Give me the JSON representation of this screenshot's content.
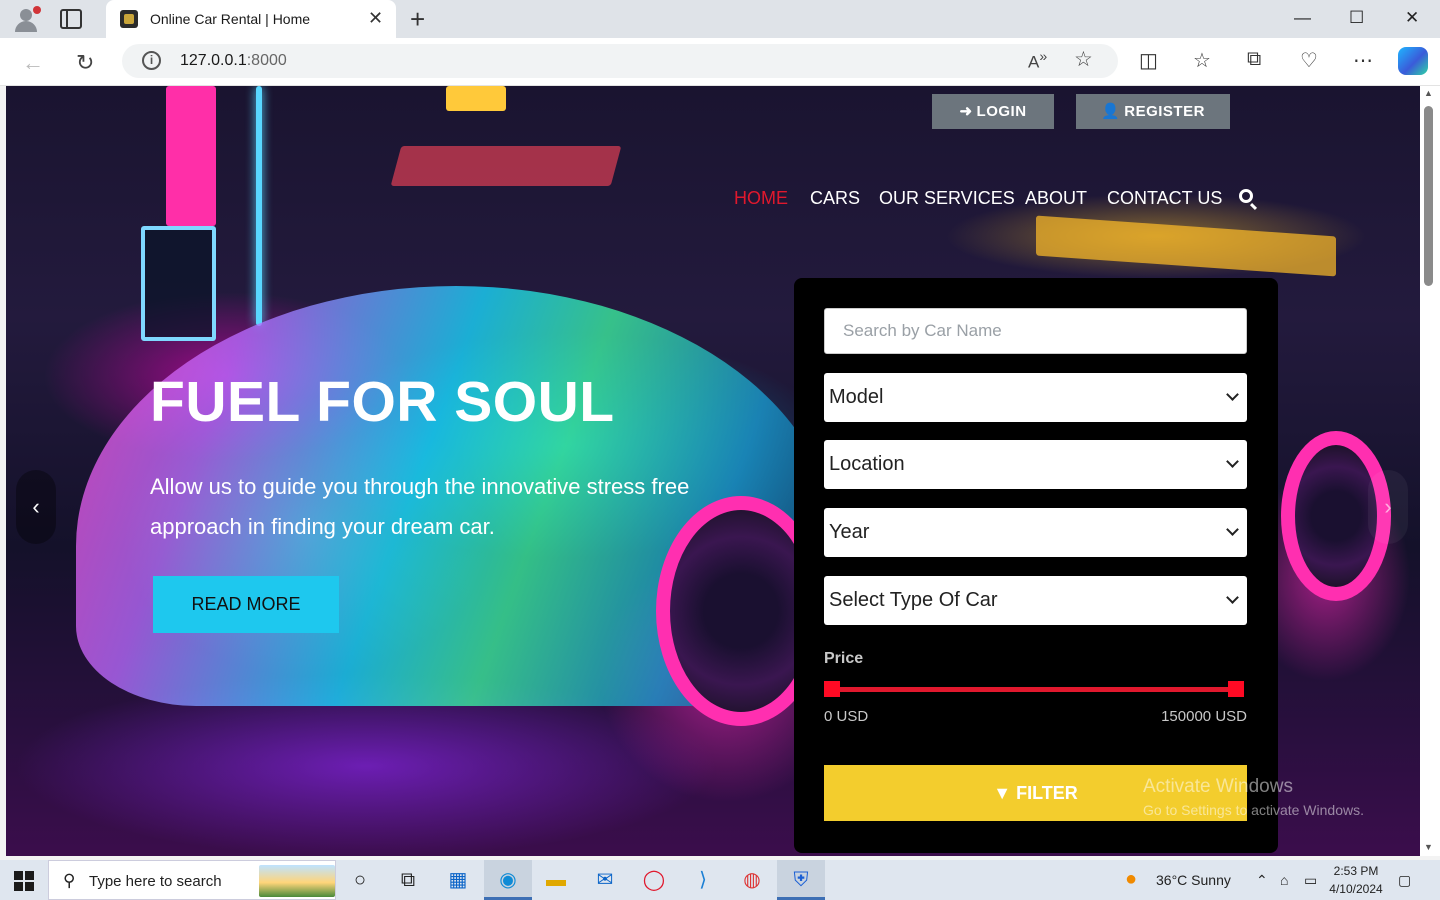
{
  "browser": {
    "tab_title": "Online Car Rental | Home",
    "url_host": "127.0.0.1",
    "url_port": ":8000",
    "new_tab_symbol": "+",
    "close_tab_symbol": "✕",
    "minimize_symbol": "—",
    "maximize_symbol": "☐",
    "close_symbol": "✕"
  },
  "header": {
    "login_label": "LOGIN",
    "register_label": "REGISTER",
    "nav": [
      {
        "label": "HOME",
        "active": true
      },
      {
        "label": "CARS",
        "active": false
      },
      {
        "label": "OUR SERVICES",
        "active": false
      },
      {
        "label": "ABOUT",
        "active": false
      },
      {
        "label": "CONTACT US",
        "active": false
      }
    ]
  },
  "hero": {
    "title": "FUEL FOR SOUL",
    "subtitle": "Allow us to guide you through the innovative stress free approach in finding your dream car.",
    "cta_label": "READ MORE"
  },
  "filter": {
    "search_placeholder": "Search by Car Name",
    "selects": [
      {
        "value": "Model"
      },
      {
        "value": "Location"
      },
      {
        "value": "Year"
      },
      {
        "value": "Select Type Of Car"
      }
    ],
    "price_label": "Price",
    "price_min_label": "0 USD",
    "price_max_label": "150000 USD",
    "price_range": [
      0,
      150000
    ],
    "button_label": "FILTER"
  },
  "watermark": {
    "line1": "Activate Windows",
    "line2": "Go to Settings to activate Windows."
  },
  "taskbar": {
    "search_placeholder": "Type here to search",
    "weather": "36°C  Sunny",
    "time": "2:53 PM",
    "date": "4/10/2024"
  },
  "colors": {
    "accent_red": "#e0182d",
    "cta_cyan": "#1ec8ee",
    "filter_yellow": "#f3cd2d",
    "auth_gray": "#6c757d"
  }
}
